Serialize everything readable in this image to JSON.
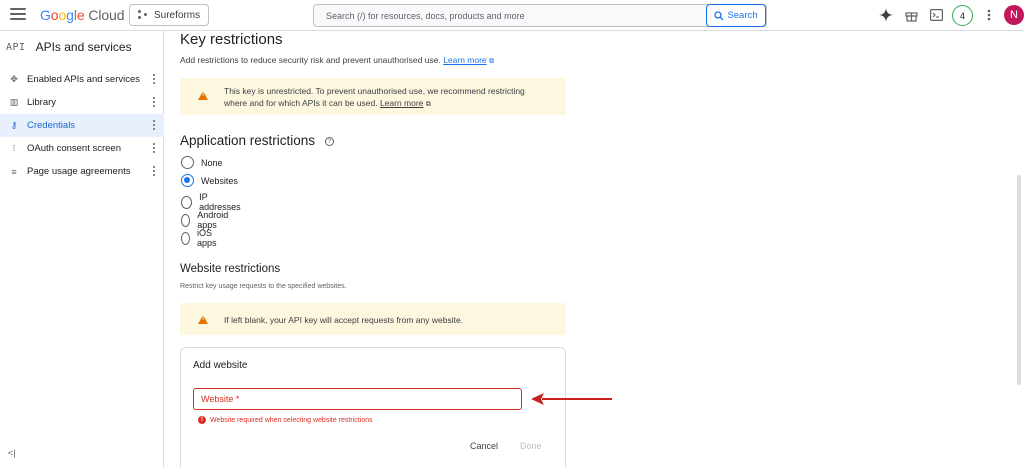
{
  "header": {
    "logo": {
      "g": "G",
      "o1": "o",
      "o2": "o",
      "g2": "g",
      "l": "l",
      "e": "e",
      "cloud": " Cloud"
    },
    "project_label": "Sureforms",
    "search_placeholder": "Search (/) for resources, docs, products and more",
    "search_button": "Search",
    "notifications_count": "4",
    "avatar_initial": "N"
  },
  "sidebar": {
    "api_badge": "API",
    "title": "APIs and services",
    "items": [
      {
        "label": "Enabled APIs and services",
        "icon": "apis-icon"
      },
      {
        "label": "Library",
        "icon": "library-icon"
      },
      {
        "label": "Credentials",
        "icon": "key-icon",
        "active": true
      },
      {
        "label": "OAuth consent screen",
        "icon": "oauth-icon"
      },
      {
        "label": "Page usage agreements",
        "icon": "agreements-icon"
      }
    ],
    "collapse_glyph": "<|"
  },
  "main": {
    "key_restrictions": {
      "title": "Key restrictions",
      "subtitle": "Add restrictions to reduce security risk and prevent unauthorised use.",
      "learn_more": "Learn more"
    },
    "warning1": {
      "line1": "This key is unrestricted. To prevent unauthorised use, we recommend restricting",
      "line2": "where and for which APIs it can be used.",
      "learn_more": "Learn more"
    },
    "application_restrictions": {
      "title": "Application restrictions",
      "options": [
        "None",
        "Websites",
        "IP addresses",
        "Android apps",
        "iOS apps"
      ],
      "selected": "Websites"
    },
    "website_restrictions": {
      "title": "Website restrictions",
      "subtitle": "Restrict key usage requests to the specified websites."
    },
    "warning2": {
      "text": "If left blank, your API key will accept requests from any website."
    },
    "add_website": {
      "title": "Add website",
      "field_label": "Website *",
      "error": "Website required when selecting website restrictions",
      "cancel": "Cancel",
      "done": "Done"
    }
  },
  "colors": {
    "accent": "#1a73e8",
    "error": "#d93025",
    "warning_bg": "#fef7e0",
    "warning_icon": "#e37400",
    "arrow": "#c5221f"
  }
}
